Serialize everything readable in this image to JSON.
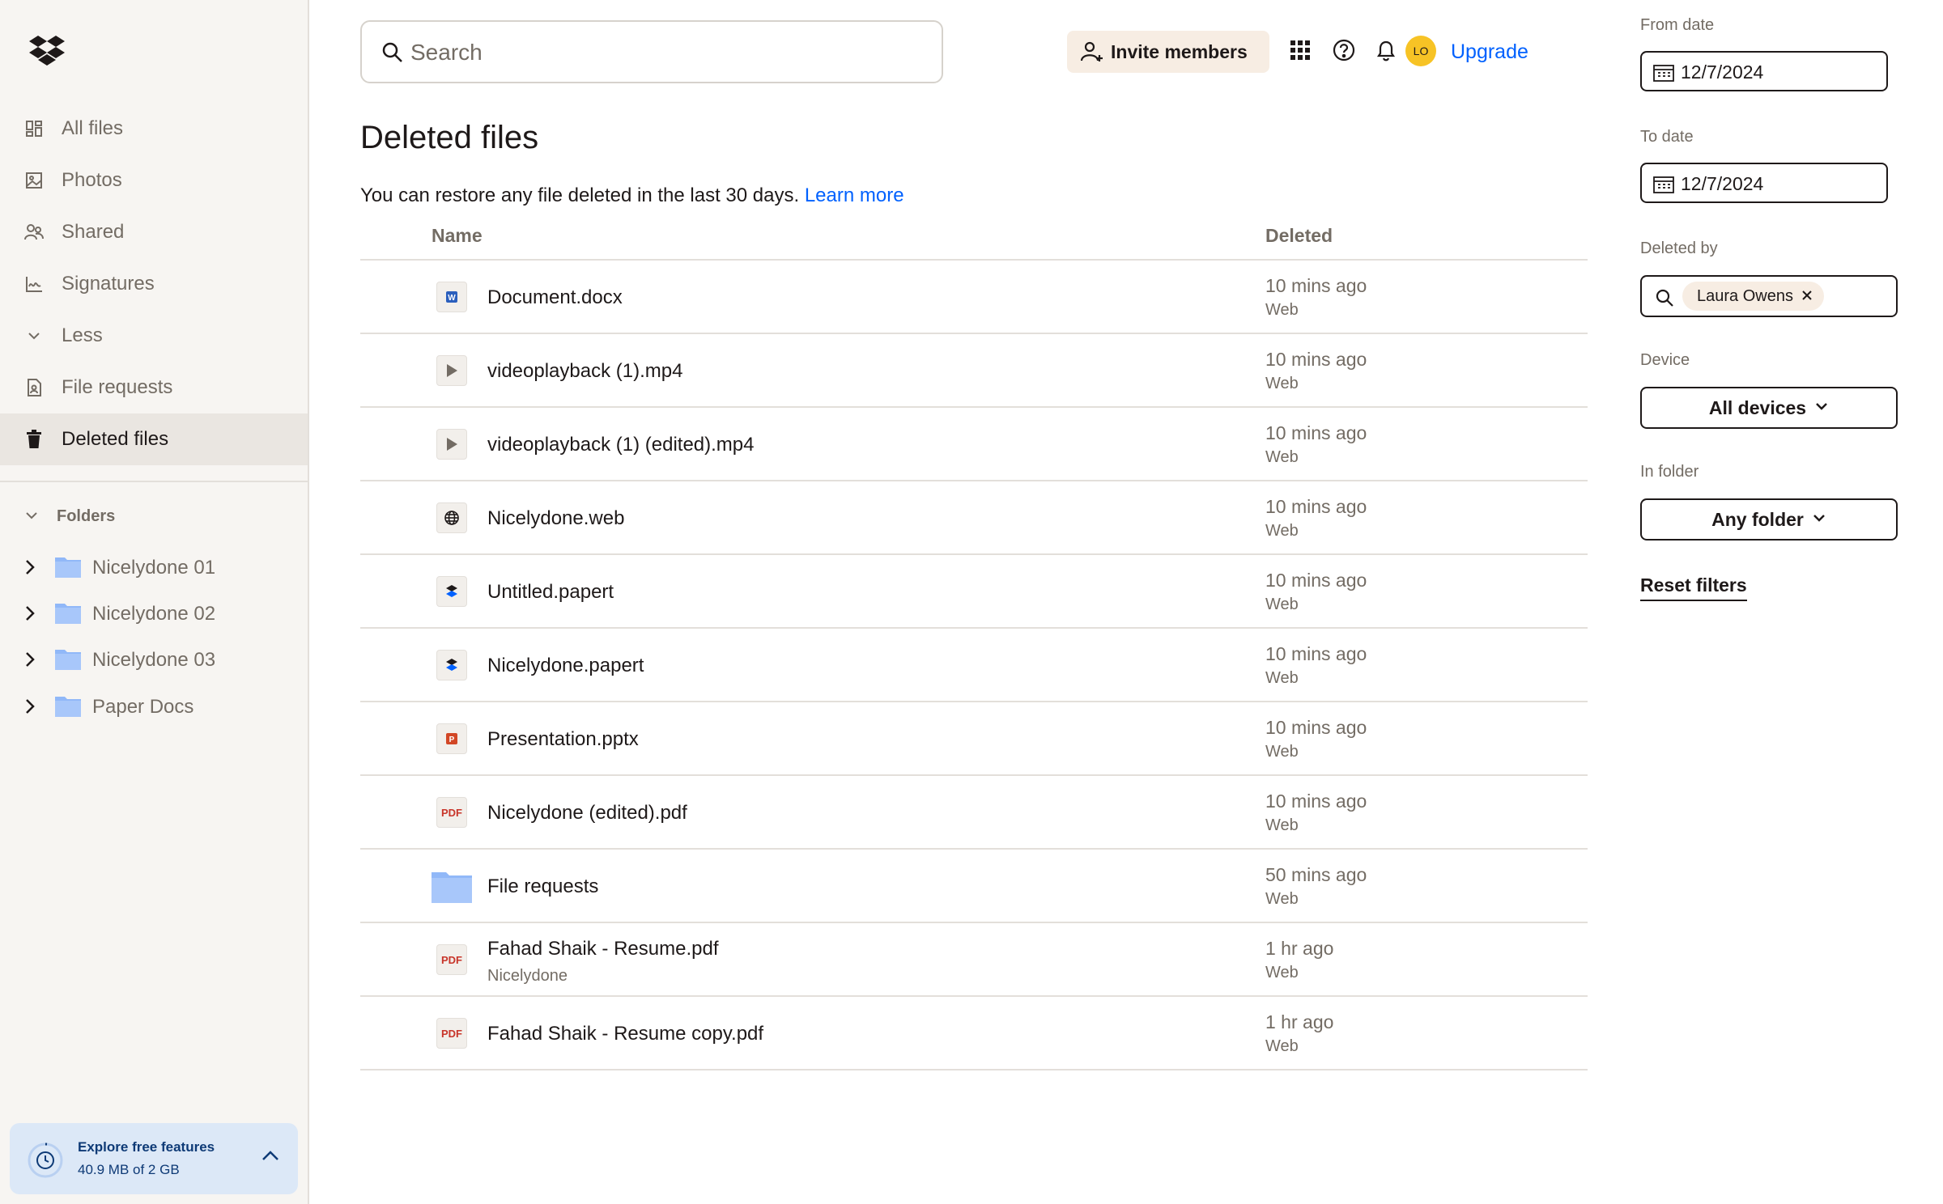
{
  "sidebar": {
    "nav": [
      {
        "label": "All files",
        "icon": "all-files-icon"
      },
      {
        "label": "Photos",
        "icon": "photos-icon"
      },
      {
        "label": "Shared",
        "icon": "shared-icon"
      },
      {
        "label": "Signatures",
        "icon": "signature-icon"
      },
      {
        "label": "Less",
        "icon": "chevron-down-icon"
      },
      {
        "label": "File requests",
        "icon": "file-request-icon"
      },
      {
        "label": "Deleted files",
        "icon": "trash-icon",
        "active": true
      }
    ],
    "folders_label": "Folders",
    "folders": [
      {
        "label": "Nicelydone 01"
      },
      {
        "label": "Nicelydone 02"
      },
      {
        "label": "Nicelydone 03"
      },
      {
        "label": "Paper Docs"
      }
    ],
    "explore": {
      "title": "Explore free features",
      "usage": "40.9 MB of 2 GB"
    }
  },
  "topbar": {
    "search_placeholder": "Search",
    "invite_label": "Invite members",
    "avatar_initials": "LO",
    "upgrade_label": "Upgrade"
  },
  "main": {
    "title": "Deleted files",
    "notice": "You can restore any file deleted in the last 30 days.",
    "learn_more": "Learn more",
    "columns": {
      "name": "Name",
      "deleted": "Deleted"
    },
    "rows": [
      {
        "name": "Document.docx",
        "sub": "",
        "when": "10 mins ago",
        "device": "Web",
        "type": "word-icon"
      },
      {
        "name": "videoplayback (1).mp4",
        "sub": "",
        "when": "10 mins ago",
        "device": "Web",
        "type": "video-icon"
      },
      {
        "name": "videoplayback (1) (edited).mp4",
        "sub": "",
        "when": "10 mins ago",
        "device": "Web",
        "type": "video-icon"
      },
      {
        "name": "Nicelydone.web",
        "sub": "",
        "when": "10 mins ago",
        "device": "Web",
        "type": "web-icon"
      },
      {
        "name": "Untitled.papert",
        "sub": "",
        "when": "10 mins ago",
        "device": "Web",
        "type": "paper-icon"
      },
      {
        "name": "Nicelydone.papert",
        "sub": "",
        "when": "10 mins ago",
        "device": "Web",
        "type": "paper-icon"
      },
      {
        "name": "Presentation.pptx",
        "sub": "",
        "when": "10 mins ago",
        "device": "Web",
        "type": "powerpoint-icon"
      },
      {
        "name": "Nicelydone (edited).pdf",
        "sub": "",
        "when": "10 mins ago",
        "device": "Web",
        "type": "pdf-icon",
        "tag": "PDF"
      },
      {
        "name": "File requests",
        "sub": "",
        "when": "50 mins ago",
        "device": "Web",
        "type": "folder-icon"
      },
      {
        "name": "Fahad Shaik - Resume.pdf",
        "sub": "Nicelydone",
        "when": "1 hr ago",
        "device": "Web",
        "type": "pdf-icon",
        "tag": "PDF"
      },
      {
        "name": "Fahad Shaik - Resume copy.pdf",
        "sub": "",
        "when": "1 hr ago",
        "device": "Web",
        "type": "pdf-icon",
        "tag": "PDF"
      }
    ]
  },
  "filters": {
    "from_label": "From date",
    "from_value": "12/7/2024",
    "to_label": "To date",
    "to_value": "12/7/2024",
    "deleted_by_label": "Deleted by",
    "deleted_by_chip": "Laura Owens",
    "device_label": "Device",
    "device_value": "All devices",
    "folder_label": "In folder",
    "folder_value": "Any folder",
    "reset_label": "Reset filters"
  },
  "colors": {
    "accent": "#0061fe",
    "sidebar_bg": "#f7f5f2",
    "active_bg": "#eae6e1",
    "invite_bg": "#f7ede3",
    "avatar": "#f7c325",
    "explore_bg": "#dce8f7"
  }
}
